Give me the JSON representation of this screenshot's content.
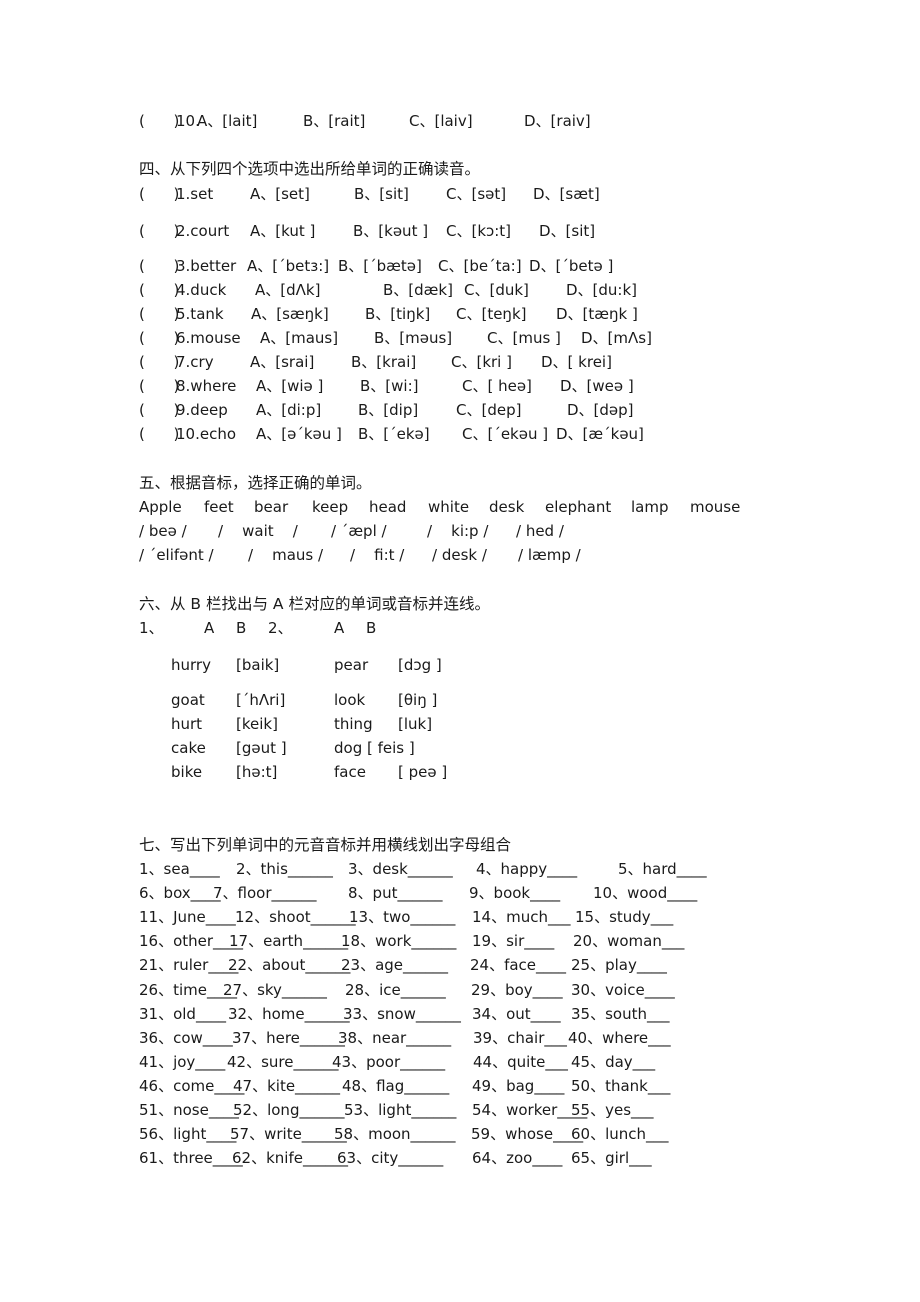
{
  "section3_tail": {
    "paren": "(      )",
    "items": [
      {
        "num": "10.",
        "options": [
          "A、[lait]",
          "B、[rait]",
          "C、[laiv]",
          "D、[raiv]"
        ]
      }
    ]
  },
  "section4": {
    "heading": "四、从下列四个选项中选出所给单词的正确读音。",
    "paren": "(      )",
    "items": [
      {
        "label": "1.set",
        "options": [
          "A、[set]",
          "B、[sit]",
          "C、[sət]",
          "D、[sæt]"
        ]
      },
      {
        "label": "2.court",
        "options": [
          "A、[kut ]",
          "B、[kəut ]",
          "C、[kɔ:t]",
          "D、[sit]"
        ]
      },
      {
        "label": "3.better",
        "options": [
          "A、[ˊbetɜ:]",
          "B、[ˊbætə]",
          "C、[beˊta:]",
          "D、[ˊbetə ]"
        ]
      },
      {
        "label": "4.duck",
        "options": [
          "A、[dΛk]",
          "B、[dæk]",
          "C、[duk]",
          "D、[du:k]"
        ]
      },
      {
        "label": "5.tank",
        "options": [
          "A、[sæŋk]",
          "B、[tiŋk]",
          "C、[teŋk]",
          "D、[tæŋk ]"
        ]
      },
      {
        "label": "6.mouse",
        "options": [
          "A、[maus]",
          "B、[məus]",
          "C、[mus ]",
          "D、[mΛs]"
        ]
      },
      {
        "label": "7.cry",
        "options": [
          "A、[srai]",
          "B、[krai]",
          "C、[kri ]",
          "D、[ krei]"
        ]
      },
      {
        "label": "8.where",
        "options": [
          "A、[wiə ]",
          "B、[wi:]",
          "C、[ heə]",
          "D、[weə ]"
        ]
      },
      {
        "label": "9.deep",
        "options": [
          "A、[di:p]",
          "B、[dip]",
          "C、[dep]",
          "D、[dəp]"
        ]
      },
      {
        "label": "10.echo",
        "options": [
          "A、[əˊkəu ]",
          "B、[ˊekə]",
          "C、[ˊekəu ]",
          "D、[æˊkəu]"
        ]
      }
    ]
  },
  "section5": {
    "heading": "五、根据音标，选择正确的单词。",
    "words": [
      "Apple",
      "feet",
      "bear",
      "keep",
      "head",
      "white",
      "desk",
      "elephant",
      "lamp",
      "mouse"
    ],
    "phonetics_row1": [
      "/ beə /",
      "/    wait    /",
      "/ ˊæpl /",
      "/    ki:p /",
      "/ hed /"
    ],
    "phonetics_row2": [
      "/ ˊelifənt /",
      "/    maus /",
      "/    fi:t /",
      "/ desk /",
      "/ læmp /"
    ]
  },
  "section6": {
    "heading": "六、从 B 栏找出与 A 栏对应的单词或音标并连线。",
    "group1_label": "1、",
    "group2_label": "2、",
    "col_a": "A",
    "col_b": "B",
    "group1": {
      "a": [
        "hurry",
        "goat",
        "hurt",
        "cake",
        "bike"
      ],
      "b": [
        "[baik]",
        "[ˊhΛri]",
        "[keik]",
        "[gəut ]",
        "[hə:t]"
      ]
    },
    "group2": {
      "a": [
        "pear",
        "look",
        "thing",
        "dog [ feis ]",
        "face"
      ],
      "b": [
        "[dɔg ]",
        "[θiŋ ]",
        "[luk]",
        "",
        "[ peə ]"
      ]
    }
  },
  "section7": {
    "heading": "七、写出下列单词中的元音音标并用横线划出字母组合",
    "rows": [
      [
        "1、sea____",
        "2、this______",
        "3、desk______",
        "4、happy____",
        "5、hard____"
      ],
      [
        "6、box____",
        "7、floor______",
        "8、put______",
        "9、book____",
        "10、wood____"
      ],
      [
        "11、June____",
        "12、shoot______",
        "13、two______",
        "14、much___",
        "15、study___"
      ],
      [
        "16、other____",
        "17、earth______",
        "18、work______",
        "19、sir____",
        "20、woman___"
      ],
      [
        "21、ruler____",
        "22、about______",
        "23、age______",
        "24、face____",
        "25、play____"
      ],
      [
        "26、time____",
        "27、sky______",
        "28、ice______",
        "29、boy____",
        "30、voice____"
      ],
      [
        "31、old____",
        "32、home______",
        "33、snow______",
        "34、out____",
        "35、south___"
      ],
      [
        "36、cow____",
        "37、here______",
        "38、near______",
        "39、chair___",
        "40、where___"
      ],
      [
        "41、joy____",
        "42、sure______",
        "43、poor______",
        "44、quite___",
        "45、day___"
      ],
      [
        "46、come____",
        "47、kite______",
        "48、flag______",
        "49、bag____",
        "50、thank___"
      ],
      [
        "51、nose____",
        "52、long______",
        "53、light______",
        "54、worker____",
        "55、yes___"
      ],
      [
        "56、light____",
        "57、write______",
        "58、moon______",
        "59、whose____",
        "60、lunch___"
      ],
      [
        "61、three____",
        "62、knife______",
        "63、city______",
        "64、zoo____",
        "65、girl___"
      ]
    ]
  }
}
